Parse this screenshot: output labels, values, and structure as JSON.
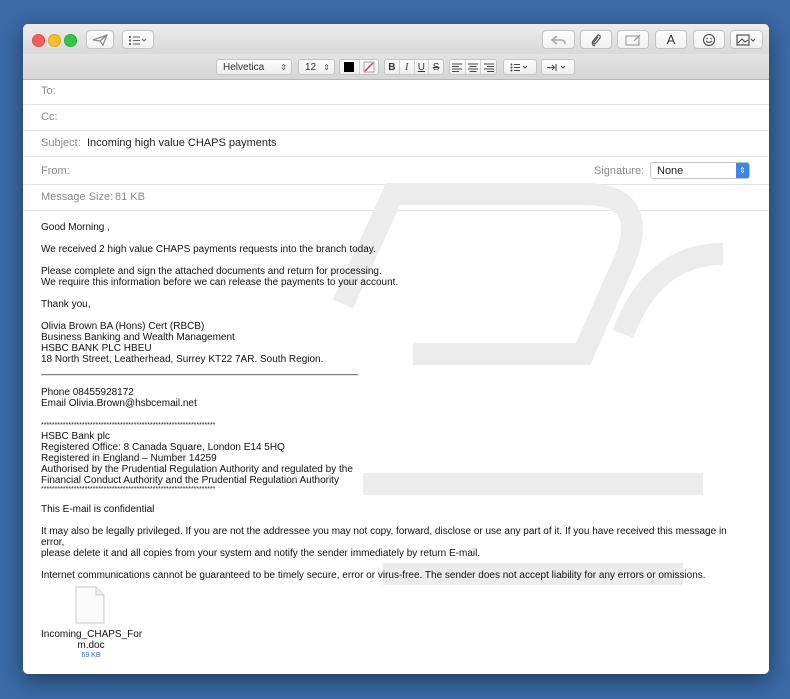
{
  "toolbar": {
    "format_font": "Helvetica",
    "format_size": "12",
    "bold": "B",
    "italic": "I",
    "underline": "U",
    "strike": "S",
    "font_button": "A"
  },
  "headers": {
    "to_label": "To:",
    "cc_label": "Cc:",
    "subject_label": "Subject:",
    "subject_value": "Incoming high value CHAPS payments",
    "from_label": "From:",
    "signature_label": "Signature:",
    "signature_value": "None",
    "size_label": "Message Size:",
    "size_value": "81 KB"
  },
  "body": {
    "greeting": "Good Morning ,",
    "p1": "We received 2 high value CHAPS payments requests into the branch today.",
    "p2_1": "Please complete and sign the attached documents and return for processing.",
    "p2_2": "We require this information before we can release the payments to your account.",
    "thanks": "Thank you,",
    "sig_1": "Olivia Brown BA (Hons) Cert (RBCB)",
    "sig_2": "Business Banking and Wealth Management",
    "sig_3": "HSBC BANK PLC HBEU",
    "sig_4": "18 North Street, Leatherhead, Surrey KT22 7AR. South Region.",
    "rule": "_________________________________________________________",
    "phone": "Phone 08455928172",
    "email": "Email Olivia.Brown@hsbcemail.net",
    "stars": "****************************************************************",
    "legal_1": "HSBC Bank plc",
    "legal_2": "Registered Office: 8 Canada Square, London E14 5HQ",
    "legal_3": "Registered in England – Number 14259",
    "legal_4": "Authorised by the Prudential Regulation Authority and regulated by the",
    "legal_5": "Financial Conduct Authority and the Prudential Regulation Authority",
    "confidential": "This E-mail is confidential",
    "privileged_1": "It may also be legally privileged. If you are not the addressee you may not copy, forward, disclose or use any part of it. If you have received this message in error,",
    "privileged_2": "please delete it and all copies from your system and notify the sender immediately by return E-mail.",
    "internet": "Internet communications cannot be guaranteed to be timely secure, error or virus-free. The sender does not accept liability for any errors or omissions."
  },
  "attachment": {
    "name_1": "Incoming_CHAPS_For",
    "name_2": "m.doc",
    "size": "69 KB"
  },
  "colors": {
    "desktop": "#3b6aa7",
    "link_blue": "#2a6fd6"
  },
  "icons": [
    "send-icon",
    "list-icon",
    "reply-icon",
    "paperclip-icon",
    "photo-icon",
    "emoji-icon",
    "image-icon",
    "document-icon"
  ]
}
